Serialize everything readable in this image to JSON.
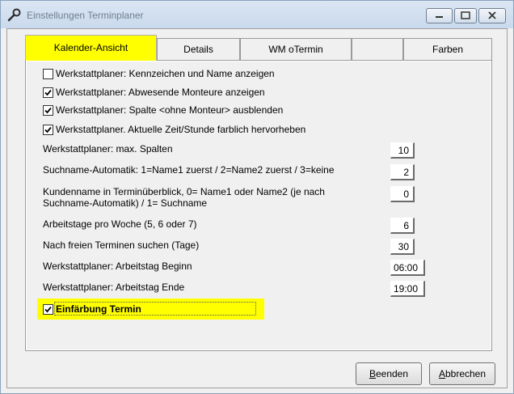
{
  "window": {
    "title": "Einstellungen Terminplaner"
  },
  "tabs": [
    {
      "label": "Kalender-Ansicht",
      "active": true
    },
    {
      "label": "Details"
    },
    {
      "label": "WM oTermin"
    },
    {
      "label": ""
    },
    {
      "label": "Farben"
    }
  ],
  "checkboxes": [
    {
      "label": "Werkstattplaner: Kennzeichen und Name anzeigen",
      "checked": false
    },
    {
      "label": "Werkstattplaner: Abwesende Monteure anzeigen",
      "checked": true
    },
    {
      "label": "Werkstattplaner: Spalte <ohne Monteur> ausblenden",
      "checked": true
    },
    {
      "label": "Werkstattplaner. Aktuelle Zeit/Stunde farblich hervorheben",
      "checked": true
    }
  ],
  "settings": [
    {
      "label": "Werkstattplaner: max. Spalten",
      "value": "10"
    },
    {
      "label": "Suchname-Automatik: 1=Name1 zuerst / 2=Name2 zuerst / 3=keine",
      "value": "2"
    },
    {
      "label": "Kundenname in Terminüberblick, 0= Name1 oder Name2 (je nach Suchname-Automatik) / 1= Suchname",
      "value": "0"
    },
    {
      "label": "Arbeitstage pro Woche (5, 6 oder 7)",
      "value": "6"
    },
    {
      "label": "Nach freien Terminen suchen (Tage)",
      "value": "30"
    },
    {
      "label": "Werkstattplaner: Arbeitstag Beginn",
      "value": "06:00"
    },
    {
      "label": "Werkstattplaner: Arbeitstag Ende",
      "value": "19:00"
    }
  ],
  "einfaerbung": {
    "label": "Einfärbung Termin",
    "checked": true
  },
  "buttons": {
    "beenden": {
      "mnemonic": "B",
      "rest": "eenden"
    },
    "abbrechen": {
      "mnemonic": "A",
      "rest": "bbrechen"
    }
  },
  "colors": {
    "tab_highlight": "#ffff00",
    "window_bg": "#f0f0f0"
  }
}
